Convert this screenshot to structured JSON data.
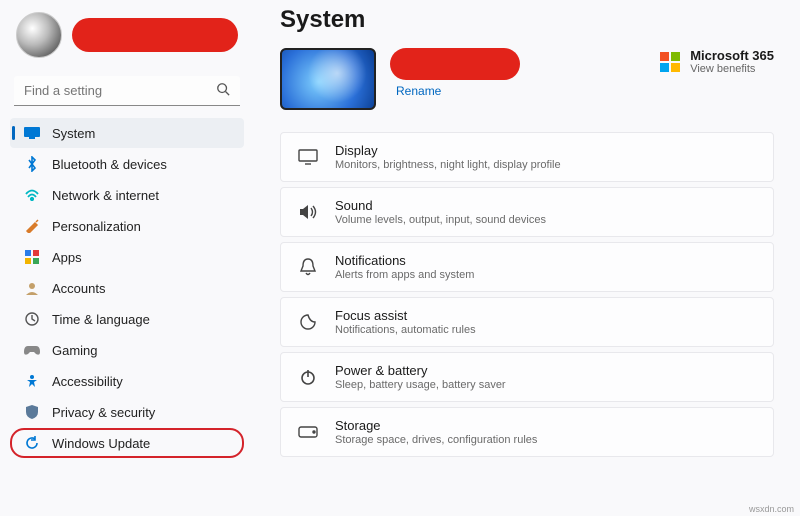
{
  "search": {
    "placeholder": "Find a setting"
  },
  "sidebar": {
    "items": [
      {
        "label": "System"
      },
      {
        "label": "Bluetooth & devices"
      },
      {
        "label": "Network & internet"
      },
      {
        "label": "Personalization"
      },
      {
        "label": "Apps"
      },
      {
        "label": "Accounts"
      },
      {
        "label": "Time & language"
      },
      {
        "label": "Gaming"
      },
      {
        "label": "Accessibility"
      },
      {
        "label": "Privacy & security"
      },
      {
        "label": "Windows Update"
      }
    ]
  },
  "main": {
    "title": "System",
    "rename": "Rename",
    "ms365": {
      "title": "Microsoft 365",
      "sub": "View benefits"
    },
    "cards": [
      {
        "title": "Display",
        "sub": "Monitors, brightness, night light, display profile"
      },
      {
        "title": "Sound",
        "sub": "Volume levels, output, input, sound devices"
      },
      {
        "title": "Notifications",
        "sub": "Alerts from apps and system"
      },
      {
        "title": "Focus assist",
        "sub": "Notifications, automatic rules"
      },
      {
        "title": "Power & battery",
        "sub": "Sleep, battery usage, battery saver"
      },
      {
        "title": "Storage",
        "sub": "Storage space, drives, configuration rules"
      }
    ]
  },
  "watermark": "wsxdn.com"
}
